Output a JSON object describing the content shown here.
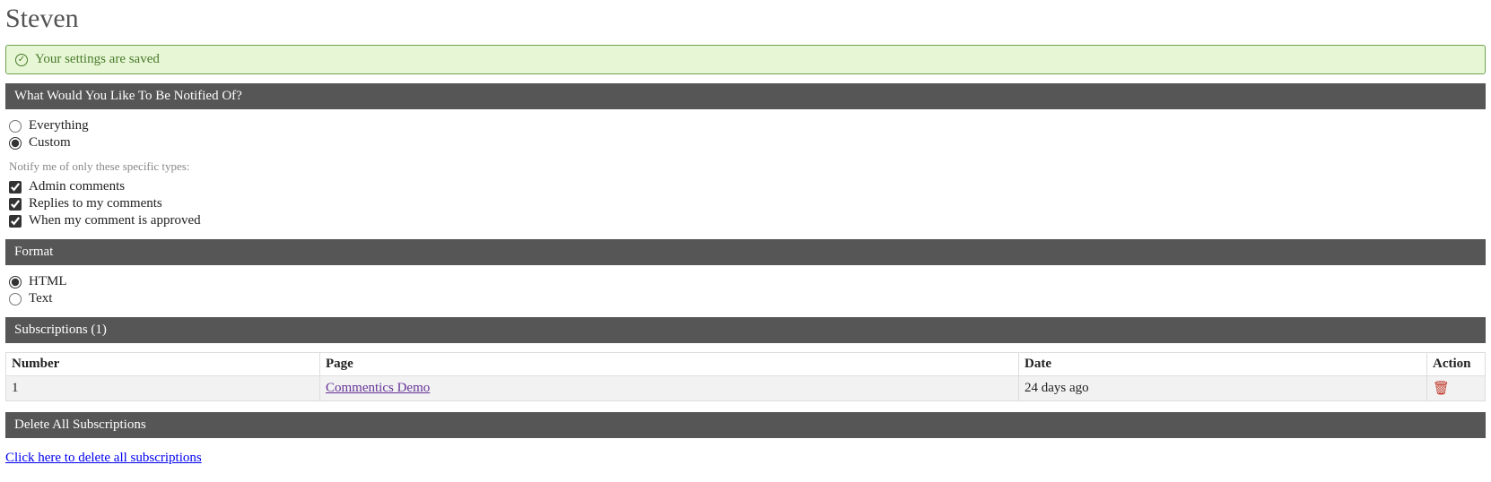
{
  "title": "Steven",
  "alert": {
    "text": "Your settings are saved"
  },
  "notify": {
    "header": "What Would You Like To Be Notified Of?",
    "everything": "Everything",
    "custom": "Custom",
    "hint": "Notify me of only these specific types:",
    "types": {
      "admin": "Admin comments",
      "replies": "Replies to my comments",
      "approved": "When my comment is approved"
    }
  },
  "format": {
    "header": "Format",
    "html": "HTML",
    "text": "Text"
  },
  "subs": {
    "header": "Subscriptions (1)",
    "cols": {
      "number": "Number",
      "page": "Page",
      "date": "Date",
      "action": "Action"
    },
    "rows": [
      {
        "number": "1",
        "page": "Commentics Demo",
        "date": "24 days ago"
      }
    ]
  },
  "delete": {
    "header": "Delete All Subscriptions",
    "link": "Click here to delete all subscriptions"
  }
}
